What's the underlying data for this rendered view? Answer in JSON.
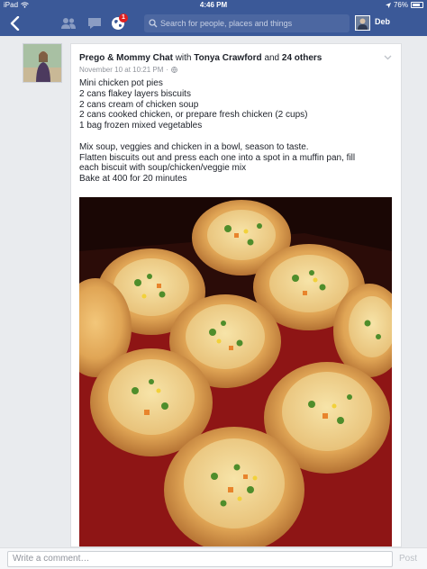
{
  "status_bar": {
    "device": "iPad",
    "time": "4:46 PM",
    "battery": "76%"
  },
  "nav": {
    "search_placeholder": "Search for people, places and things",
    "notification_count": "1",
    "user_name": "Deb"
  },
  "post": {
    "group": "Prego & Mommy Chat",
    "with_text": "with",
    "tagged_person": "Tonya Crawford",
    "and_text": "and",
    "others": "24 others",
    "timestamp": "November 10 at 10:21 PM",
    "lines": [
      "Mini chicken pot pies",
      "2 cans flakey layers biscuits",
      "2 cans cream of chicken soup",
      "2 cans cooked chicken, or prepare fresh chicken (2 cups)",
      "1 bag frozen mixed vegetables"
    ],
    "directions": [
      "Mix soup, veggies and chicken in a bowl, season to taste.",
      "Flatten biscuits out and press each one into a spot in a muffin pan, fill",
      "each biscuit with soup/chicken/veggie mix",
      "Bake at 400 for 20 minutes"
    ]
  },
  "comment_bar": {
    "placeholder": "Write a comment…",
    "post_label": "Post"
  },
  "colors": {
    "brand": "#3b5998",
    "badge": "#e02020"
  },
  "icons": [
    "back-icon",
    "friends-icon",
    "messages-icon",
    "globe-icon",
    "search-icon",
    "chevron-down-icon",
    "audience-icon",
    "wifi-icon",
    "battery-icon"
  ]
}
